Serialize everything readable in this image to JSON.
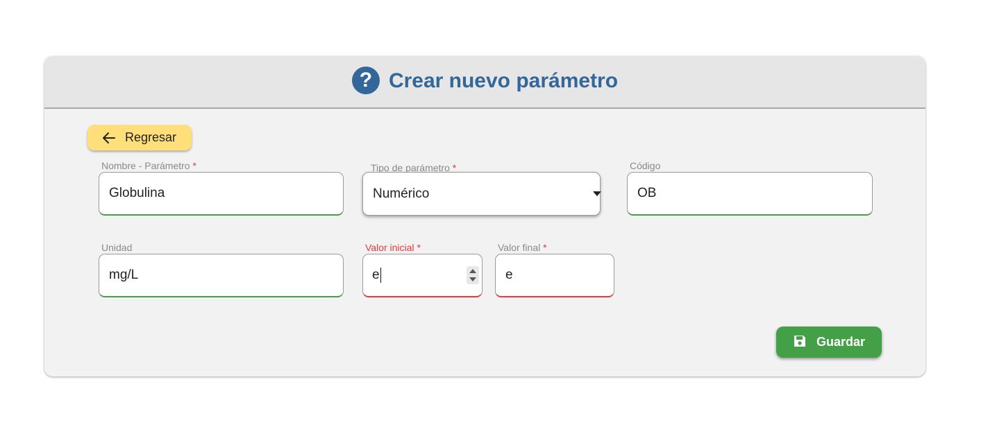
{
  "header": {
    "title": "Crear nuevo parámetro",
    "icon": "help-circle-icon",
    "title_color": "#336699"
  },
  "back_button": {
    "label": "Regresar",
    "icon": "arrow-left-icon",
    "color": "#ffdf7a"
  },
  "form": {
    "nombre": {
      "label": "Nombre - Parámetro",
      "required": "*",
      "value": "Globulina"
    },
    "tipo": {
      "label": "Tipo de parámetro",
      "required": "*",
      "value": "Numérico"
    },
    "codigo": {
      "label": "Código",
      "value": "OB"
    },
    "unidad": {
      "label": "Unidad",
      "value": "mg/L"
    },
    "valor_inicial": {
      "label": "Valor inicial",
      "required": "*",
      "value": "e"
    },
    "valor_final": {
      "label": "Valor final",
      "required": "*",
      "value": "e"
    }
  },
  "save_button": {
    "label": "Guardar",
    "icon": "floppy-disk-icon",
    "color": "#43a047"
  },
  "colors": {
    "valid": "#43a047",
    "error": "#e53935"
  }
}
